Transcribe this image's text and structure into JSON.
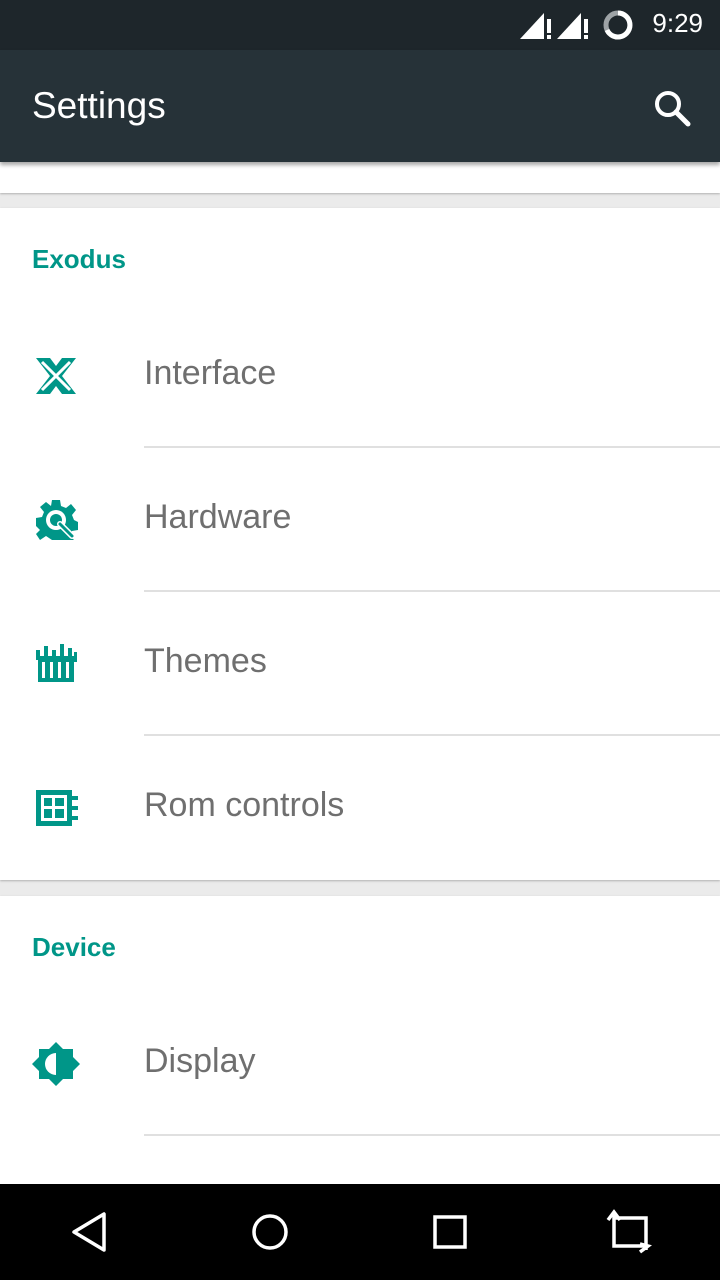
{
  "status_bar": {
    "time": "9:29",
    "icons": [
      "signal-no-data-icon",
      "signal-no-data-icon",
      "sync-icon"
    ]
  },
  "app_bar": {
    "title": "Settings",
    "search_icon": "search-icon"
  },
  "sections": [
    {
      "title": "Exodus",
      "items": [
        {
          "label": "Interface",
          "icon": "interface-icon"
        },
        {
          "label": "Hardware",
          "icon": "hardware-icon"
        },
        {
          "label": "Themes",
          "icon": "themes-icon"
        },
        {
          "label": "Rom controls",
          "icon": "rom-controls-icon"
        }
      ]
    },
    {
      "title": "Device",
      "items": [
        {
          "label": "Display",
          "icon": "display-icon"
        }
      ]
    }
  ],
  "nav_bar": [
    "back-icon",
    "home-icon",
    "recents-icon",
    "rotate-icon"
  ],
  "colors": {
    "accent": "#009688",
    "app_bar": "#263238",
    "status_bar": "#1e262b",
    "item_text": "#6f6f6f"
  }
}
